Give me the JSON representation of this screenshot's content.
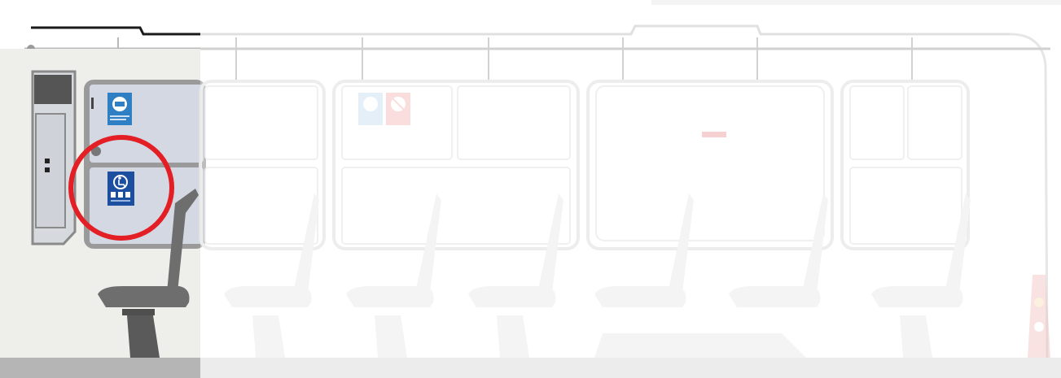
{
  "scene": {
    "highlighted_area": "wheelchair-sign",
    "colors": {
      "focus_ring": "#e31e24",
      "sign_blue": "#1c4fa0",
      "sign_light_blue": "#2f7fc4",
      "no_smoking_red": "#e31e24",
      "floor": "#b5b5b5",
      "panel": "#d3d8e3",
      "seat": "#6e6e6e"
    },
    "icons": {
      "info_sign": "bus-info-icon",
      "wheelchair_sign": "wheelchair-icon",
      "no_smoking_sign": "no-smoking-icon",
      "clock_sign": "clock-icon"
    }
  }
}
